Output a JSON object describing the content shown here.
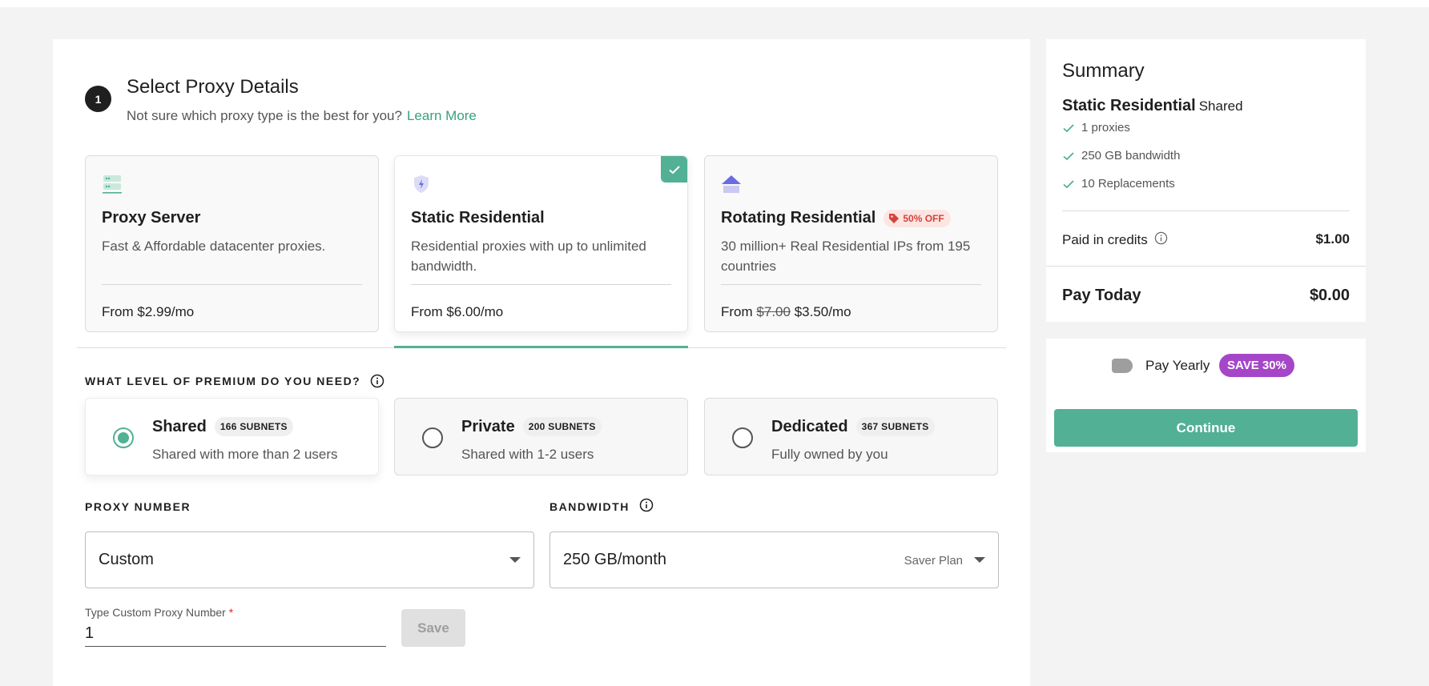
{
  "step": {
    "number": "1",
    "title": "Select Proxy Details",
    "subtitle": "Not sure which proxy type is the best for you?",
    "learn_more": "Learn More"
  },
  "proxy_types": [
    {
      "name": "Proxy Server",
      "desc": "Fast & Affordable datacenter proxies.",
      "price": "From $2.99/mo",
      "icon": "server-icon",
      "selected": false
    },
    {
      "name": "Static Residential",
      "desc": "Residential proxies with up to unlimited bandwidth.",
      "price": "From $6.00/mo",
      "icon": "shield-bolt-icon",
      "selected": true
    },
    {
      "name": "Rotating Residential",
      "desc": "30 million+ Real Residential IPs from 195 countries",
      "price_prefix": "From",
      "price_old": "$7.00",
      "price_new": "$3.50/mo",
      "badge": "50% OFF",
      "icon": "home-icon",
      "selected": false
    }
  ],
  "premium": {
    "question": "WHAT LEVEL OF PREMIUM DO YOU NEED?",
    "tiers": [
      {
        "name": "Shared",
        "subnets": "166 SUBNETS",
        "desc": "Shared with more than 2 users",
        "selected": true
      },
      {
        "name": "Private",
        "subnets": "200 SUBNETS",
        "desc": "Shared with 1-2 users",
        "selected": false
      },
      {
        "name": "Dedicated",
        "subnets": "367 SUBNETS",
        "desc": "Fully owned by you",
        "selected": false
      }
    ]
  },
  "proxy_number": {
    "label": "PROXY NUMBER",
    "value": "Custom",
    "custom_label": "Type Custom Proxy Number",
    "required_mark": "*",
    "custom_value": "1",
    "save_label": "Save"
  },
  "bandwidth": {
    "label": "BANDWIDTH",
    "value": "250 GB/month",
    "plan": "Saver Plan"
  },
  "summary": {
    "title": "Summary",
    "product": "Static Residential",
    "tier": "Shared",
    "features": [
      "1 proxies",
      "250 GB bandwidth",
      "10 Replacements"
    ],
    "credits_label": "Paid in credits",
    "credits_value": "$1.00",
    "pay_today_label": "Pay Today",
    "pay_today_value": "$0.00"
  },
  "payment": {
    "pay_yearly_label": "Pay Yearly",
    "save_badge": "SAVE 30%",
    "continue_label": "Continue"
  },
  "colors": {
    "accent": "#52b095",
    "badge_purple": "#a546c8",
    "off_red": "#d4433a"
  }
}
